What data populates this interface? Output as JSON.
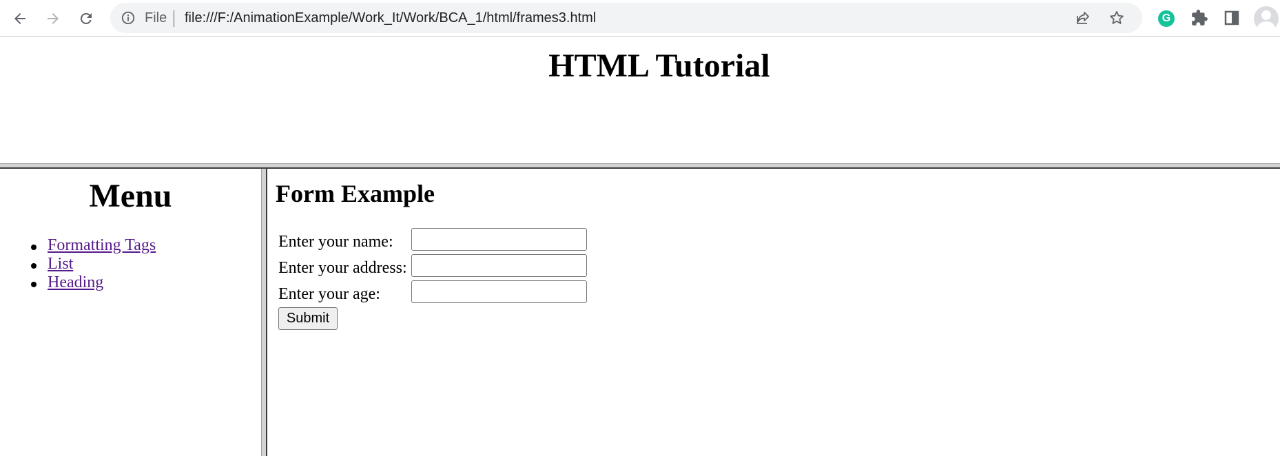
{
  "browser": {
    "file_label": "File",
    "url": "file:///F:/AnimationExample/Work_It/Work/BCA_1/html/frames3.html",
    "extension_badge": "G"
  },
  "top_frame": {
    "heading": "HTML Tutorial"
  },
  "menu": {
    "heading": "Menu",
    "links": [
      "Formatting Tags",
      "List",
      "Heading"
    ],
    "link_color": "#551a8b"
  },
  "form": {
    "heading": "Form Example",
    "fields": [
      {
        "label": "Enter your name:",
        "value": ""
      },
      {
        "label": "Enter your address:",
        "value": ""
      },
      {
        "label": "Enter your age:",
        "value": ""
      }
    ],
    "submit_label": "Submit"
  }
}
